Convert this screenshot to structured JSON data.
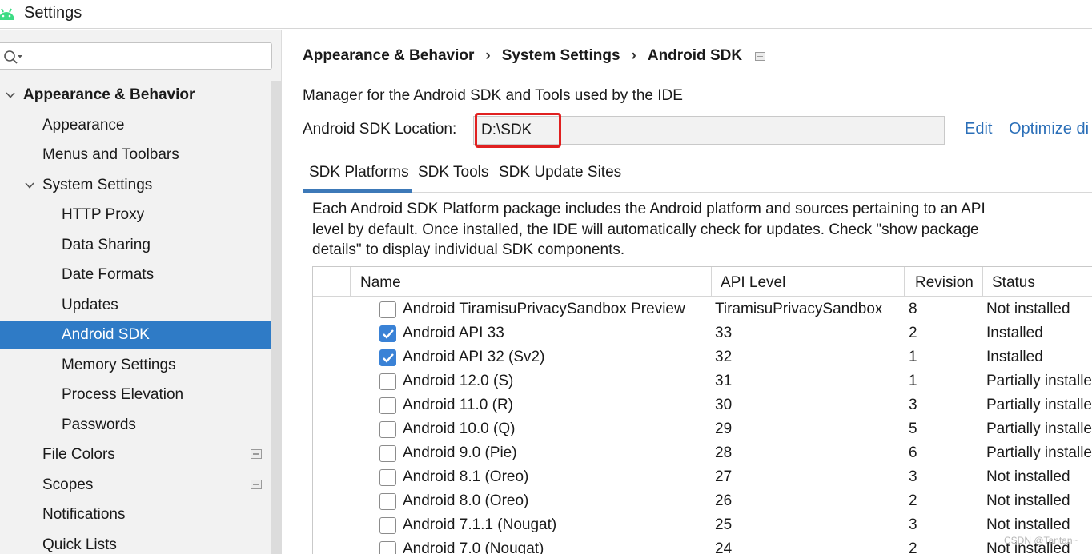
{
  "window": {
    "title": "Settings"
  },
  "sidebar": {
    "items": [
      {
        "label": "Appearance & Behavior",
        "level": 0,
        "expanded": true,
        "bold": true
      },
      {
        "label": "Appearance",
        "level": 1
      },
      {
        "label": "Menus and Toolbars",
        "level": 1
      },
      {
        "label": "System Settings",
        "level": 1,
        "expanded": true
      },
      {
        "label": "HTTP Proxy",
        "level": 2
      },
      {
        "label": "Data Sharing",
        "level": 2
      },
      {
        "label": "Date Formats",
        "level": 2
      },
      {
        "label": "Updates",
        "level": 2
      },
      {
        "label": "Android SDK",
        "level": 2,
        "selected": true
      },
      {
        "label": "Memory Settings",
        "level": 2
      },
      {
        "label": "Process Elevation",
        "level": 2
      },
      {
        "label": "Passwords",
        "level": 2
      },
      {
        "label": "File Colors",
        "level": 1,
        "project_icon": true
      },
      {
        "label": "Scopes",
        "level": 1,
        "project_icon": true
      },
      {
        "label": "Notifications",
        "level": 1
      },
      {
        "label": "Quick Lists",
        "level": 1
      }
    ]
  },
  "breadcrumb": {
    "part1": "Appearance & Behavior",
    "sep1": "›",
    "part2": "System Settings",
    "sep2": "›",
    "part3": "Android SDK"
  },
  "main": {
    "description": "Manager for the Android SDK and Tools used by the IDE",
    "location_label": "Android SDK Location:",
    "location_value": "D:\\SDK",
    "edit_label": "Edit",
    "optimize_label": "Optimize di",
    "tabs": [
      "SDK Platforms",
      "SDK Tools",
      "SDK Update Sites"
    ],
    "info_text": "Each Android SDK Platform package includes the Android platform and sources pertaining to an API level by default. Once installed, the IDE will automatically check for updates. Check \"show package details\" to display individual SDK components."
  },
  "table": {
    "columns": [
      "Name",
      "API Level",
      "Revision",
      "Status"
    ],
    "rows": [
      {
        "name": "Android TiramisuPrivacySandbox Preview",
        "api": "TiramisuPrivacySandbox",
        "revision": "8",
        "status": "Not installed",
        "checked": false
      },
      {
        "name": "Android API 33",
        "api": "33",
        "revision": "2",
        "status": "Installed",
        "checked": true
      },
      {
        "name": "Android API 32 (Sv2)",
        "api": "32",
        "revision": "1",
        "status": "Installed",
        "checked": true
      },
      {
        "name": "Android 12.0 (S)",
        "api": "31",
        "revision": "1",
        "status": "Partially installe",
        "checked": false
      },
      {
        "name": "Android 11.0 (R)",
        "api": "30",
        "revision": "3",
        "status": "Partially installe",
        "checked": false
      },
      {
        "name": "Android 10.0 (Q)",
        "api": "29",
        "revision": "5",
        "status": "Partially installe",
        "checked": false
      },
      {
        "name": "Android 9.0 (Pie)",
        "api": "28",
        "revision": "6",
        "status": "Partially installe",
        "checked": false
      },
      {
        "name": "Android 8.1 (Oreo)",
        "api": "27",
        "revision": "3",
        "status": "Not installed",
        "checked": false
      },
      {
        "name": "Android 8.0 (Oreo)",
        "api": "26",
        "revision": "2",
        "status": "Not installed",
        "checked": false
      },
      {
        "name": "Android 7.1.1 (Nougat)",
        "api": "25",
        "revision": "3",
        "status": "Not installed",
        "checked": false
      },
      {
        "name": "Android 7.0 (Nougat)",
        "api": "24",
        "revision": "2",
        "status": "Not installed",
        "checked": false
      }
    ]
  },
  "watermark": "CSDN @Tantan~",
  "colors": {
    "selection": "#2f7bc6",
    "link": "#2b6fb8",
    "highlight_box": "#e02020",
    "checkbox_checked": "#3a82d6",
    "android_green": "#3ddc84"
  }
}
